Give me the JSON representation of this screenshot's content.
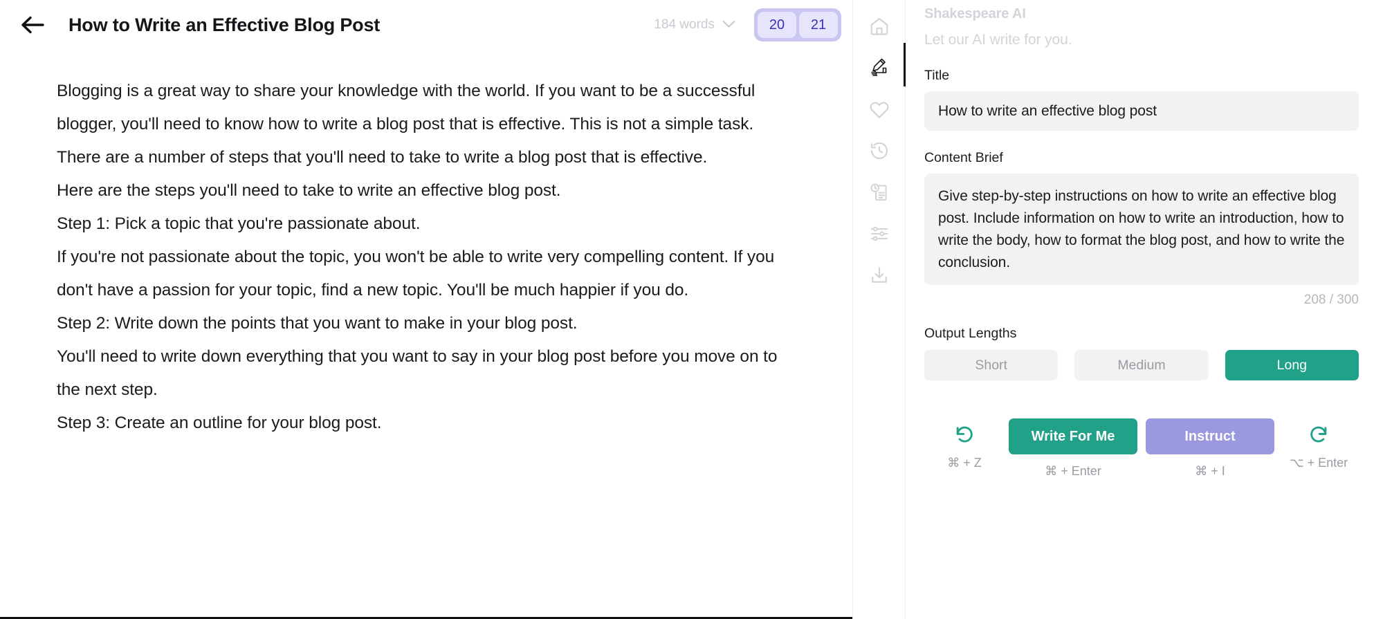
{
  "editor": {
    "back_icon": "arrow-left-icon",
    "title": "How to Write an Effective Blog Post",
    "word_count": "184 words",
    "word_count_chevron": "chevron-down-icon",
    "versions": [
      {
        "label": "20",
        "active": true
      },
      {
        "label": "21",
        "active": true
      }
    ],
    "paragraphs": [
      "Blogging is a great way to share your knowledge with the world. If you want to be a successful blogger, you'll need to know how to write a blog post that is effective. This is not a simple task. There are a number of steps that you'll need to take to write a blog post that is effective.",
      "Here are the steps you'll need to take to write an effective blog post.",
      "Step 1:  Pick a topic that you're passionate about.",
      "If you're not passionate about the topic, you won't be able to write very compelling content. If you don't have a passion for your topic, find a new topic. You'll be much happier if you do.",
      "Step 2:  Write down the points that you want to make in your blog post.",
      "You'll need to write down everything that you want to say in your blog post before you move on to the next step.",
      "Step 3:  Create an outline for your blog post."
    ]
  },
  "rail": {
    "items": [
      {
        "icon": "home-icon",
        "active": false
      },
      {
        "icon": "writing-hand-icon",
        "active": true
      },
      {
        "icon": "heart-icon",
        "active": false
      },
      {
        "icon": "history-clock-icon",
        "active": false
      },
      {
        "icon": "document-clock-icon",
        "active": false
      },
      {
        "icon": "sliders-settings-icon",
        "active": false
      },
      {
        "icon": "download-icon",
        "active": false
      }
    ]
  },
  "ai_panel": {
    "heading": "Shakespeare AI",
    "subheading": "Let our AI write for you.",
    "title_label": "Title",
    "title_value": "How to write an effective blog post",
    "title_placeholder": "Title",
    "brief_label": "Content Brief",
    "brief_value": "Give step-by-step instructions on how to write an effective blog post. Include information on how to write an introduction, how to write the body, how to format the blog post, and how to write the conclusion.",
    "brief_placeholder": "Content Brief",
    "char_count": "208 / 300",
    "output_lengths_label": "Output Lengths",
    "output_lengths": [
      {
        "label": "Short",
        "selected": false
      },
      {
        "label": "Medium",
        "selected": false
      },
      {
        "label": "Long",
        "selected": true
      }
    ],
    "undo": {
      "icon": "undo-icon",
      "shortcut": "⌘ + Z"
    },
    "write_for_me": {
      "label": "Write For Me",
      "shortcut": "⌘ + Enter"
    },
    "instruct": {
      "label": "Instruct",
      "shortcut": "⌘ + I"
    },
    "redo": {
      "icon": "redo-icon",
      "shortcut": "⌥ + Enter"
    }
  },
  "colors": {
    "accent_teal": "#21a188",
    "accent_purple": "#9a99e0",
    "version_chip_bg": "#c9c6f2",
    "field_bg": "#f2f2f3"
  }
}
